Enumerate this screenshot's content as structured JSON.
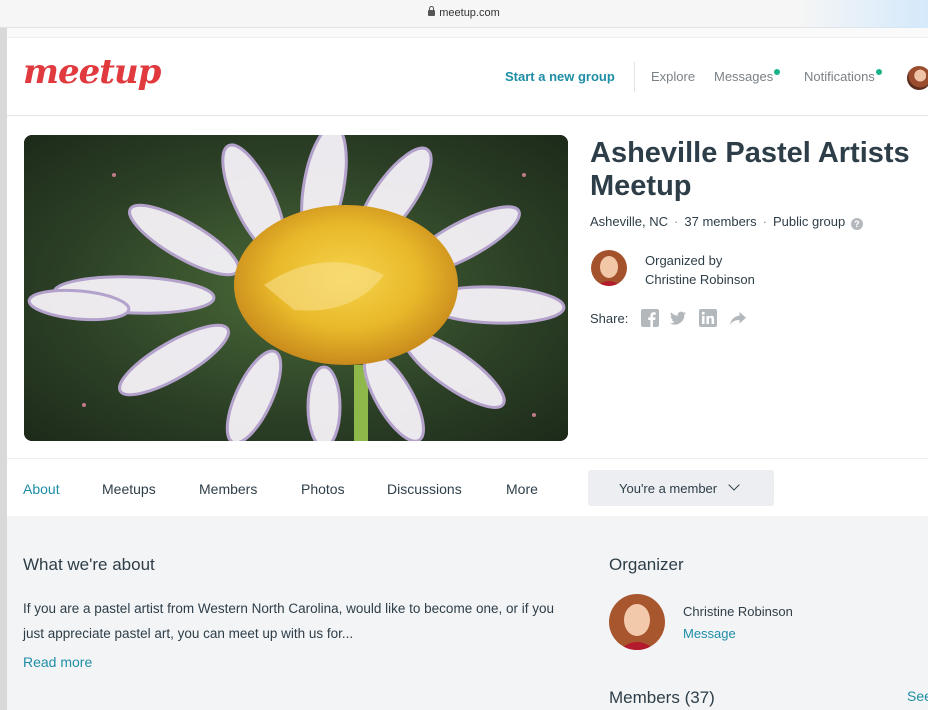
{
  "browser": {
    "url": "meetup.com"
  },
  "header": {
    "logo": "meetup",
    "start_group": "Start a new group",
    "explore": "Explore",
    "messages": "Messages",
    "notifications": "Notifications",
    "accent": "#1e8ea6",
    "dot_color": "#19b28a"
  },
  "group": {
    "title": "Asheville Pastel Artists Meetup",
    "location": "Asheville, NC",
    "members": "37 members",
    "privacy": "Public group",
    "organized_by_label": "Organized by",
    "organizer": "Christine Robinson",
    "share_label": "Share:",
    "share_icons": [
      "facebook-icon",
      "twitter-icon",
      "linkedin-icon",
      "share-arrow-icon"
    ]
  },
  "tabs": [
    {
      "label": "About",
      "active": true
    },
    {
      "label": "Meetups",
      "active": false
    },
    {
      "label": "Members",
      "active": false
    },
    {
      "label": "Photos",
      "active": false
    },
    {
      "label": "Discussions",
      "active": false
    },
    {
      "label": "More",
      "active": false
    }
  ],
  "member_button": "You're a member",
  "about": {
    "heading": "What we're about",
    "text": "If you are a pastel artist from Western North Carolina, would like to become one, or if you just appreciate pastel art, you can meet up with us for...",
    "read_more": "Read more"
  },
  "organizer_panel": {
    "heading": "Organizer",
    "name": "Christine Robinson",
    "message": "Message"
  },
  "members_panel": {
    "heading": "Members (37)",
    "see_all": "See all"
  }
}
